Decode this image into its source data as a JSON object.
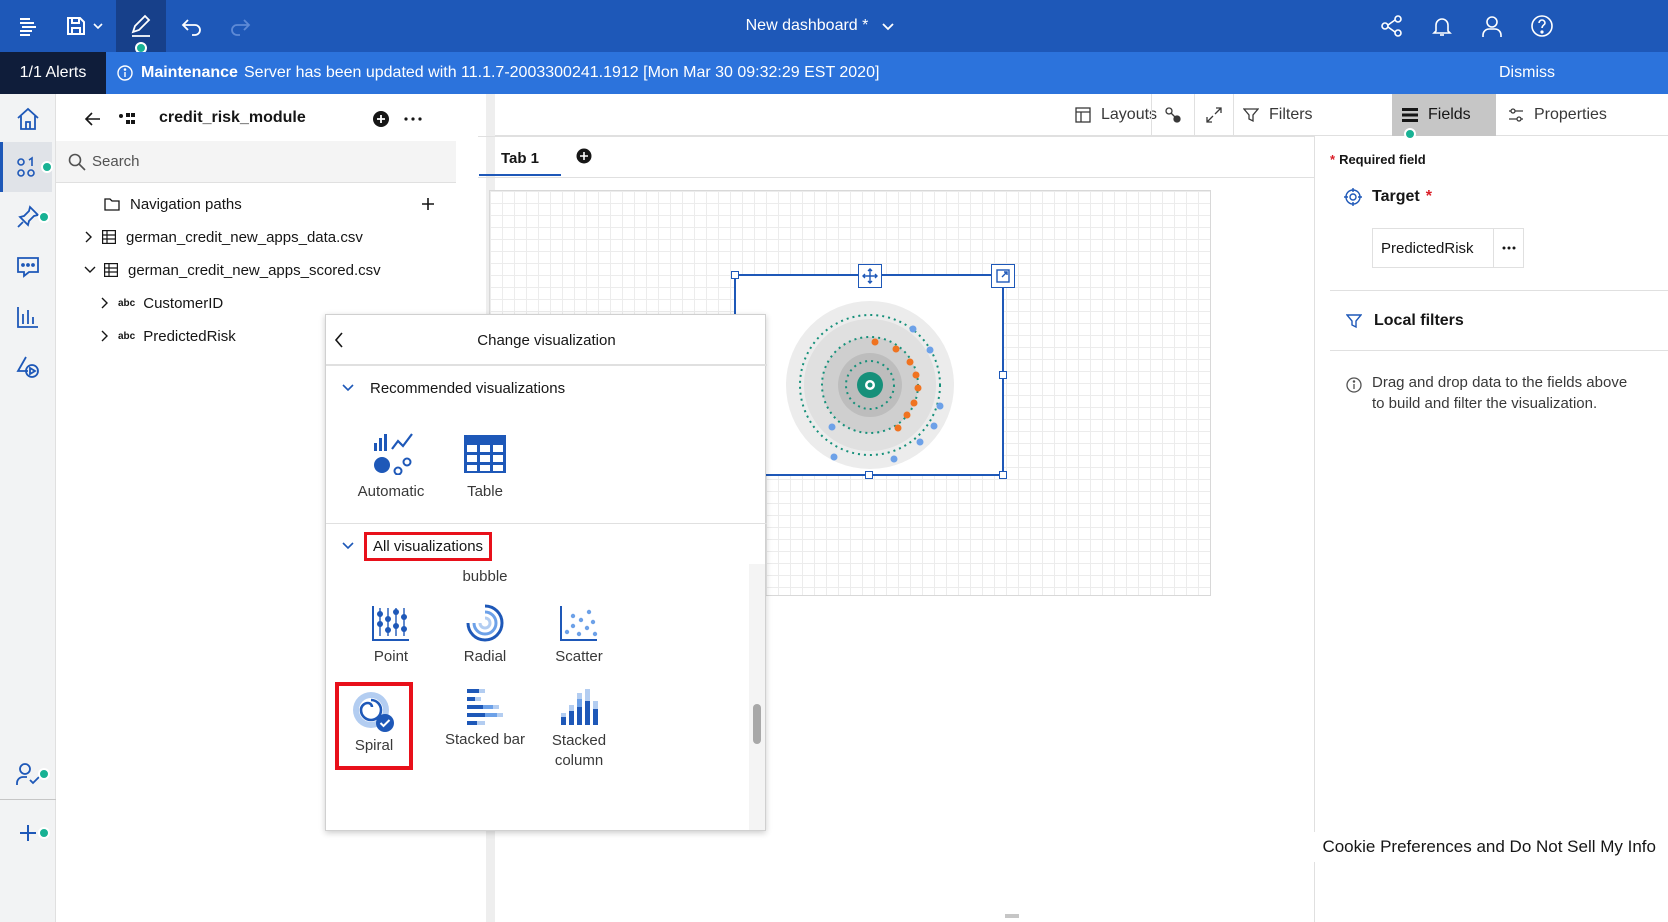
{
  "topbar": {
    "title": "New dashboard *"
  },
  "alert": {
    "count": "1/1 Alerts",
    "type": "Maintenance",
    "message": "Server has been updated with 11.1.7-2003300241.1912 [Mon Mar 30 09:32:29 EST 2020]",
    "dismiss": "Dismiss"
  },
  "datapanel": {
    "module_name": "credit_risk_module",
    "search_placeholder": "Search",
    "tree": [
      {
        "label": "Navigation paths"
      },
      {
        "label": "german_credit_new_apps_data.csv"
      },
      {
        "label": "german_credit_new_apps_scored.csv"
      },
      {
        "label": "CustomerID"
      },
      {
        "label": "PredictedRisk"
      }
    ],
    "abc": "abc"
  },
  "toolbar": {
    "layouts": "Layouts",
    "filters": "Filters",
    "fields": "Fields",
    "properties": "Properties"
  },
  "tabs": {
    "tab1": "Tab 1"
  },
  "changeviz": {
    "title": "Change visualization",
    "recommended": "Recommended visualizations",
    "automatic": "Automatic",
    "table": "Table",
    "all": "All visualizations",
    "bubble": "bubble",
    "point": "Point",
    "radial": "Radial",
    "scatter": "Scatter",
    "spiral": "Spiral",
    "stacked_bar": "Stacked bar",
    "stacked_column": "Stacked column"
  },
  "rightpanel": {
    "required": "Required field",
    "target_label": "Target",
    "target_value": "PredictedRisk",
    "local_filters": "Local filters",
    "hint": "Drag and drop data to the fields above to build and filter the visualization.",
    "asterisk": "*"
  },
  "footer": {
    "cookie": "Cookie Preferences and Do Not Sell My Info"
  },
  "colors": {
    "brand": "#1e58b8",
    "alert": "#2c73dc",
    "teal": "#18b294",
    "highlight": "#e8101a",
    "orange": "#f07320"
  }
}
